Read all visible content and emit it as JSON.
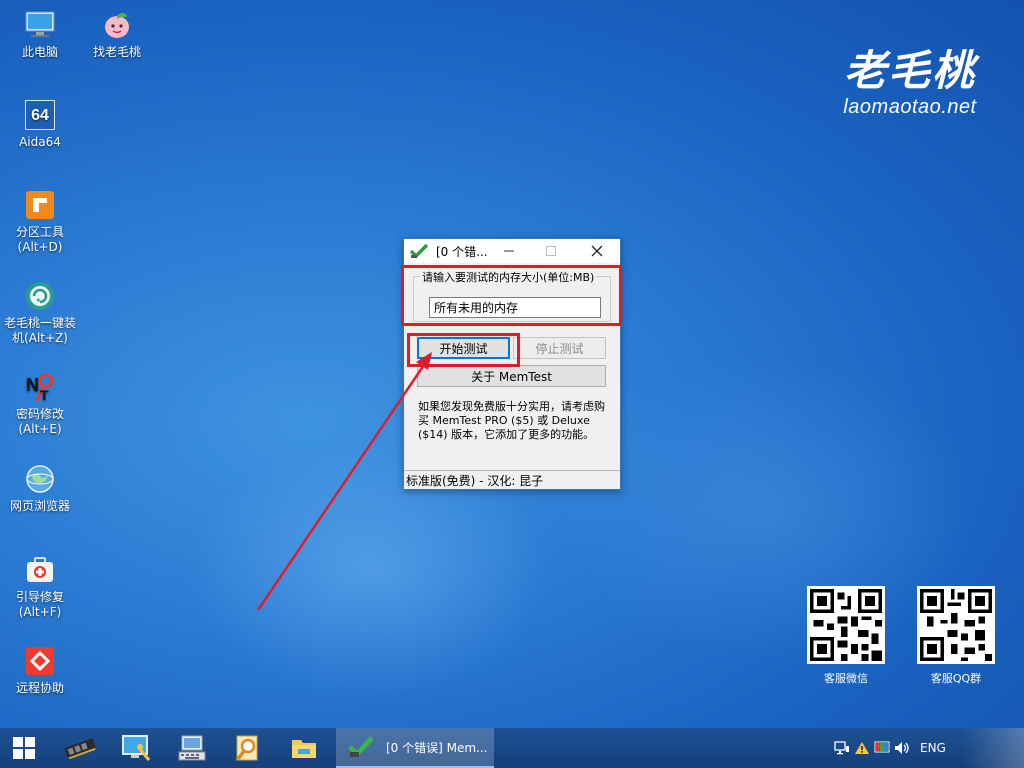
{
  "desktop": {
    "icons": [
      {
        "label": "此电脑",
        "icon": "computer-icon"
      },
      {
        "label": "找老毛桃",
        "icon": "peach-icon"
      },
      {
        "label": "Aida64",
        "icon": "aida64-icon",
        "badge": "64"
      },
      {
        "label": "分区工具",
        "label2": "(Alt+D)",
        "icon": "partition-tool-icon"
      },
      {
        "label": "老毛桃一键装",
        "label2": "机(Alt+Z)",
        "icon": "one-click-install-icon"
      },
      {
        "label": "密码修改",
        "label2": "(Alt+E)",
        "icon": "password-icon"
      },
      {
        "label": "网页浏览器",
        "icon": "web-browser-icon"
      },
      {
        "label": "引导修复",
        "label2": "(Alt+F)",
        "icon": "boot-repair-icon"
      },
      {
        "label": "远程协助",
        "icon": "remote-assist-icon"
      }
    ],
    "brand": {
      "cn": "老毛桃",
      "en": "laomaotao.net"
    },
    "qr_codes": [
      {
        "label": "客服微信"
      },
      {
        "label": "客服QQ群"
      }
    ]
  },
  "window": {
    "title": "[0 个错...",
    "group_label": "请输入要测试的内存大小(单位:MB)",
    "memory_input_value": "所有未用的内存",
    "start_button": "开始测试",
    "stop_button": "停止测试",
    "about_button": "关于 MemTest",
    "note": "如果您发现免费版十分实用，请考虑购买 MemTest PRO ($5) 或 Deluxe ($14) 版本，它添加了更多的功能。",
    "status": "标准版(免费) - 汉化: 昆子"
  },
  "taskbar": {
    "active_task": "[0 个错误] Mem...",
    "language": "ENG"
  },
  "colors": {
    "highlight": "#e21b2a",
    "taskbar": "#1a4a8a",
    "window_border": "#2f76c7"
  }
}
